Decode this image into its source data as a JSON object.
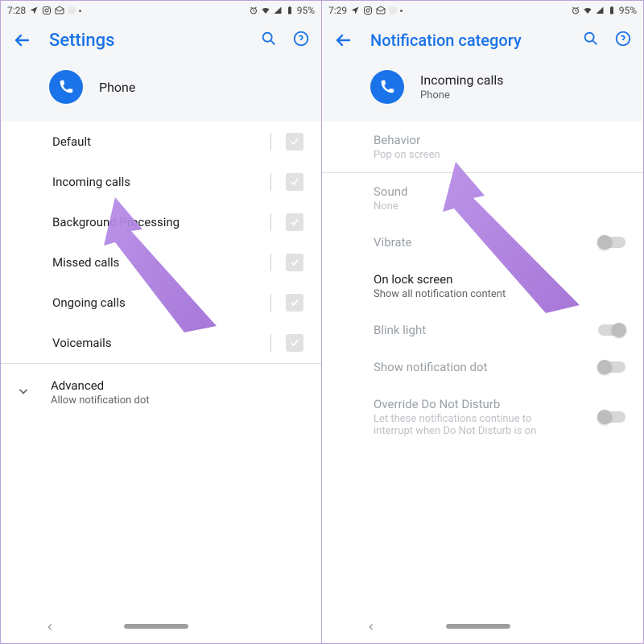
{
  "left": {
    "status": {
      "time": "7:28",
      "battery": "95%"
    },
    "title": "Settings",
    "app": {
      "name": "Phone"
    },
    "rows": [
      {
        "label": "Default"
      },
      {
        "label": "Incoming calls"
      },
      {
        "label": "Background Processing"
      },
      {
        "label": "Missed calls"
      },
      {
        "label": "Ongoing calls"
      },
      {
        "label": "Voicemails"
      }
    ],
    "advanced": {
      "label": "Advanced",
      "sub": "Allow notification dot"
    }
  },
  "right": {
    "status": {
      "time": "7:29",
      "battery": "95%"
    },
    "title": "Notification category",
    "app": {
      "name": "Incoming calls",
      "sub": "Phone"
    },
    "items": {
      "behavior": {
        "label": "Behavior",
        "sub": "Pop on screen"
      },
      "sound": {
        "label": "Sound",
        "sub": "None"
      },
      "vibrate": {
        "label": "Vibrate"
      },
      "lock": {
        "label": "On lock screen",
        "sub": "Show all notification content"
      },
      "blink": {
        "label": "Blink light"
      },
      "dot": {
        "label": "Show notification dot"
      },
      "dnd": {
        "label": "Override Do Not Disturb",
        "sub": "Let these notifications continue to interrupt when Do Not Disturb is on"
      }
    }
  }
}
